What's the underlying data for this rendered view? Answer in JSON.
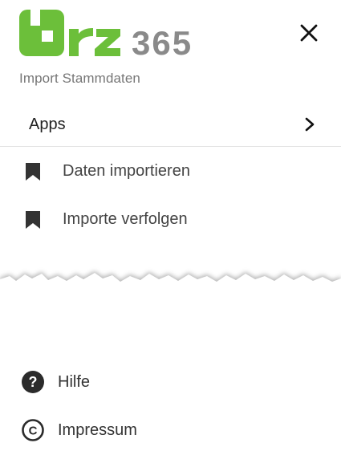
{
  "brand": {
    "logo_text": "brz 365",
    "accent_color": "#6cbf3a",
    "grey_color": "#8a8a8a"
  },
  "header": {
    "subtitle": "Import Stammdaten",
    "close_icon": "close-icon"
  },
  "apps": {
    "label": "Apps",
    "icon": "chevron-right-icon"
  },
  "nav": {
    "items": [
      {
        "label": "Daten importieren",
        "icon": "bookmark-icon"
      },
      {
        "label": "Importe verfolgen",
        "icon": "bookmark-icon"
      }
    ]
  },
  "footer": {
    "items": [
      {
        "label": "Hilfe",
        "icon": "help-circle-icon"
      },
      {
        "label": "Impressum",
        "icon": "copyright-icon"
      }
    ]
  }
}
